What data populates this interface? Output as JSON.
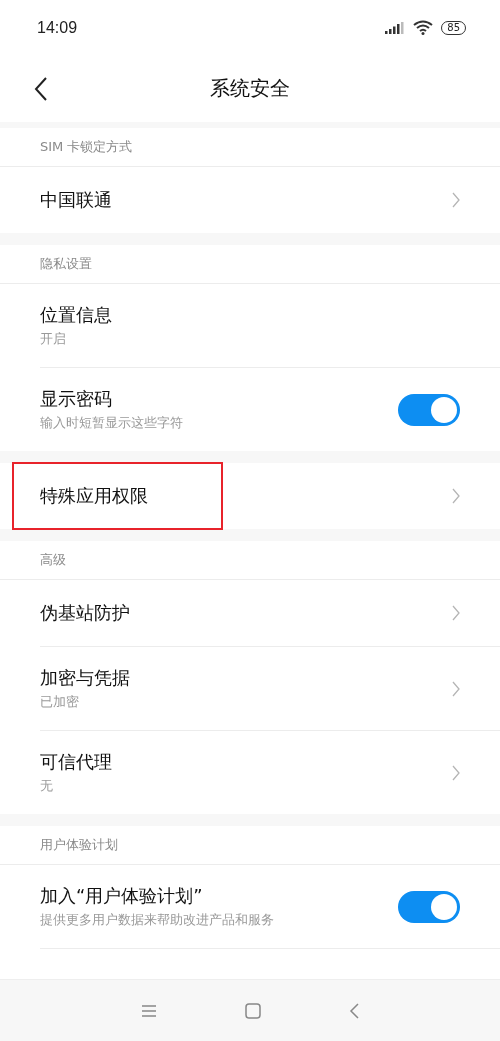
{
  "status_bar": {
    "time": "14:09",
    "battery": "85"
  },
  "header": {
    "title": "系统安全"
  },
  "sections": [
    {
      "label": "SIM 卡锁定方式",
      "items": [
        {
          "kind": "link",
          "title": "中国联通"
        }
      ]
    },
    {
      "label": "隐私设置",
      "items": [
        {
          "kind": "link",
          "title": "位置信息",
          "subtitle": "开启",
          "chevron": false
        },
        {
          "kind": "toggle",
          "title": "显示密码",
          "subtitle": "输入时短暂显示这些字符",
          "on": true
        }
      ]
    },
    {
      "items": [
        {
          "kind": "link",
          "title": "特殊应用权限",
          "highlighted": true
        }
      ]
    },
    {
      "label": "高级",
      "items": [
        {
          "kind": "link",
          "title": "伪基站防护"
        },
        {
          "kind": "link",
          "title": "加密与凭据",
          "subtitle": "已加密"
        },
        {
          "kind": "link",
          "title": "可信代理",
          "subtitle": "无"
        }
      ]
    },
    {
      "label": "用户体验计划",
      "items": [
        {
          "kind": "toggle",
          "title": "加入“用户体验计划”",
          "subtitle": "提供更多用户数据来帮助改进产品和服务",
          "on": true
        }
      ]
    }
  ]
}
